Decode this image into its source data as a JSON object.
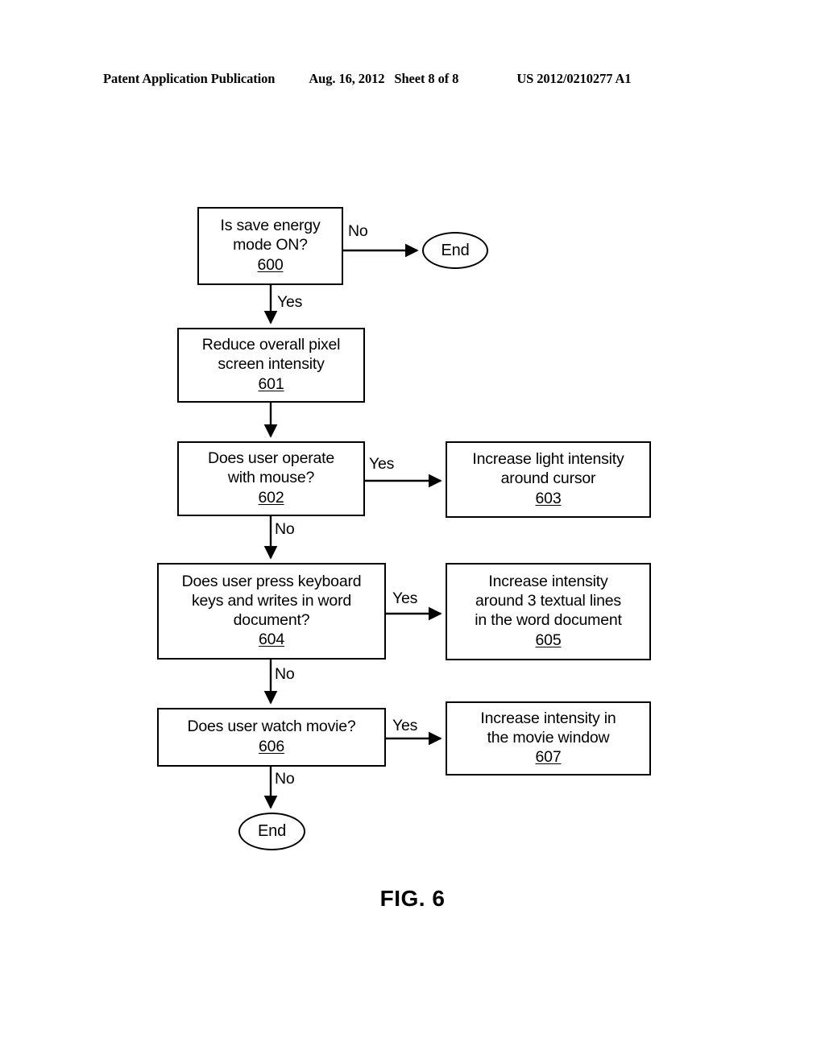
{
  "header": {
    "publication": "Patent Application Publication",
    "date": "Aug. 16, 2012",
    "sheet": "Sheet 8 of 8",
    "document_number": "US 2012/0210277 A1"
  },
  "figure": {
    "caption": "FIG. 6"
  },
  "flowchart": {
    "nodes": [
      {
        "id": "600",
        "shape": "process",
        "text": "Is save energy\nmode ON?",
        "line1": "Is save energy",
        "line2": "mode ON?",
        "ref": "600"
      },
      {
        "id": "601",
        "shape": "process",
        "text": "Reduce overall pixel\nscreen intensity",
        "line1": "Reduce overall pixel",
        "line2": "screen intensity",
        "ref": "601"
      },
      {
        "id": "602",
        "shape": "process",
        "text": "Does user operate\nwith mouse?",
        "line1": "Does user operate",
        "line2": "with mouse?",
        "ref": "602"
      },
      {
        "id": "603",
        "shape": "process",
        "text": "Increase light intensity\naround cursor",
        "line1": "Increase light intensity",
        "line2": "around cursor",
        "ref": "603"
      },
      {
        "id": "604",
        "shape": "process",
        "text": "Does user press keyboard\nkeys and writes in word\ndocument?",
        "line1": "Does user press keyboard",
        "line2": "keys and writes in word",
        "line3": "document?",
        "ref": "604"
      },
      {
        "id": "605",
        "shape": "process",
        "text": "Increase intensity\naround 3 textual lines\nin the word document",
        "line1": "Increase intensity",
        "line2": "around 3 textual lines",
        "line3": "in the word document",
        "ref": "605"
      },
      {
        "id": "606",
        "shape": "process",
        "text": "Does user watch movie?",
        "line1": "Does user watch movie?",
        "ref": "606"
      },
      {
        "id": "607",
        "shape": "process",
        "text": "Increase intensity in\nthe movie window",
        "line1": "Increase intensity in",
        "line2": "the movie window",
        "ref": "607"
      }
    ],
    "terminals": [
      {
        "id": "end-top",
        "label": "End"
      },
      {
        "id": "end-bottom",
        "label": "End"
      }
    ],
    "edges": [
      {
        "from": "600",
        "to": "end-top",
        "label": "No",
        "direction": "right"
      },
      {
        "from": "600",
        "to": "601",
        "label": "Yes",
        "direction": "down"
      },
      {
        "from": "601",
        "to": "602",
        "label": "",
        "direction": "down"
      },
      {
        "from": "602",
        "to": "603",
        "label": "Yes",
        "direction": "right"
      },
      {
        "from": "602",
        "to": "604",
        "label": "No",
        "direction": "down"
      },
      {
        "from": "604",
        "to": "605",
        "label": "Yes",
        "direction": "right"
      },
      {
        "from": "604",
        "to": "606",
        "label": "No",
        "direction": "down"
      },
      {
        "from": "606",
        "to": "607",
        "label": "Yes",
        "direction": "right"
      },
      {
        "from": "606",
        "to": "end-bottom",
        "label": "No",
        "direction": "down"
      }
    ]
  },
  "colors": {
    "ink": "#000000",
    "paper": "#ffffff"
  }
}
